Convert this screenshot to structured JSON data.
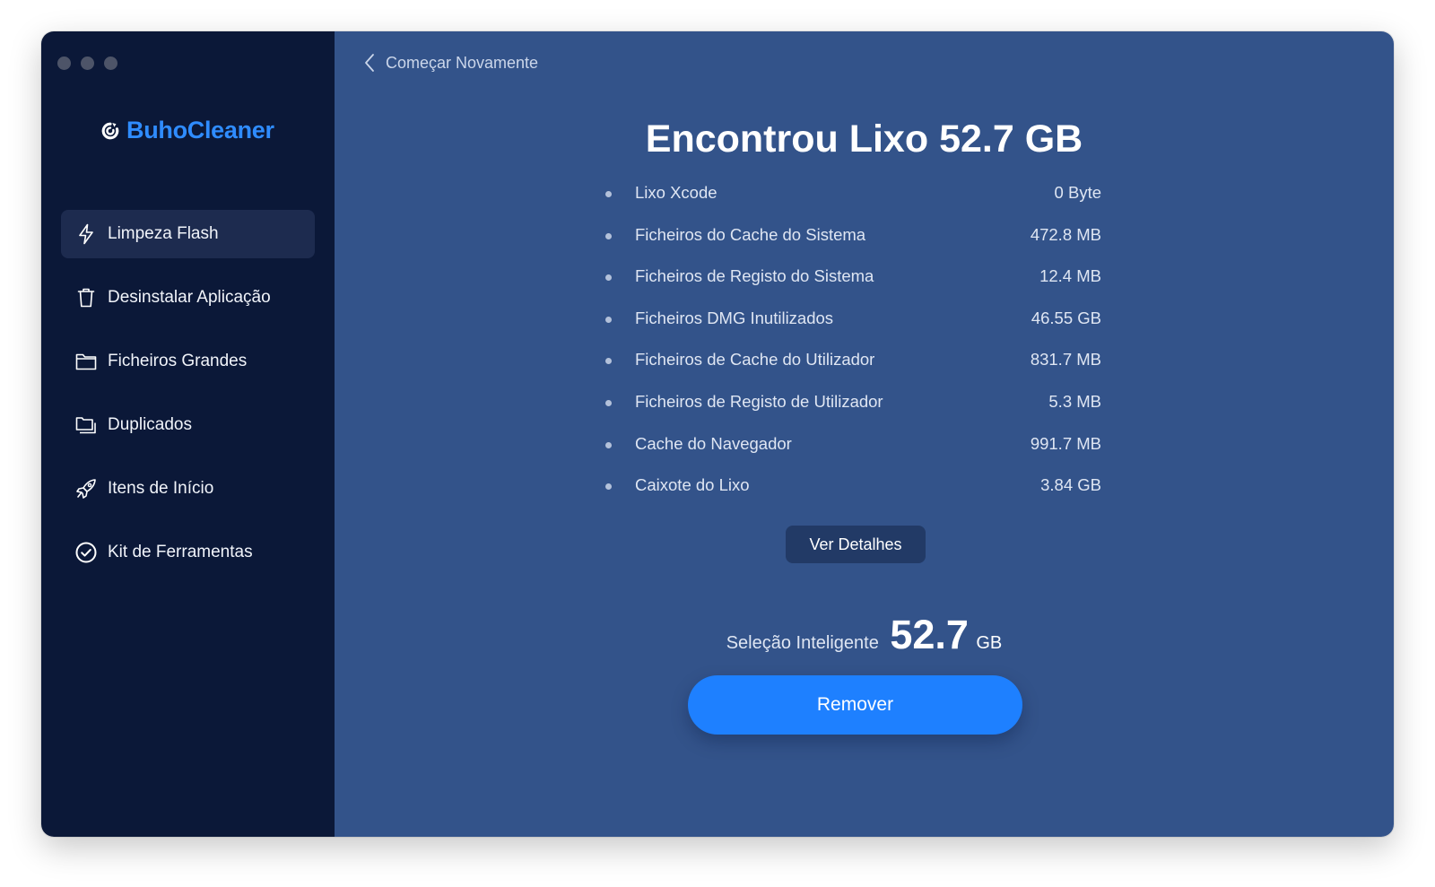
{
  "app": {
    "name": "BuhoCleaner",
    "brand_color": "#2f8cff"
  },
  "sidebar": {
    "items": [
      {
        "label": "Limpeza Flash",
        "icon": "lightning-icon",
        "active": true
      },
      {
        "label": "Desinstalar Aplicação",
        "icon": "trash-icon",
        "active": false
      },
      {
        "label": "Ficheiros Grandes",
        "icon": "folder-icon",
        "active": false
      },
      {
        "label": "Duplicados",
        "icon": "duplicate-folder-icon",
        "active": false
      },
      {
        "label": "Itens de Início",
        "icon": "rocket-icon",
        "active": false
      },
      {
        "label": "Kit de Ferramentas",
        "icon": "check-circle-icon",
        "active": false
      }
    ]
  },
  "main": {
    "back_label": "Começar Novamente",
    "headline": {
      "prefix": "Encontrou Lixo",
      "value": "52.7",
      "unit": "GB"
    },
    "items": [
      {
        "name": "Lixo Xcode",
        "size": "0 Byte"
      },
      {
        "name": "Ficheiros do Cache do Sistema",
        "size": "472.8 MB"
      },
      {
        "name": "Ficheiros de Registo do Sistema",
        "size": "12.4 MB"
      },
      {
        "name": "Ficheiros DMG Inutilizados",
        "size": "46.55 GB"
      },
      {
        "name": "Ficheiros de Cache do Utilizador",
        "size": "831.7 MB"
      },
      {
        "name": "Ficheiros de Registo de Utilizador",
        "size": "5.3 MB"
      },
      {
        "name": "Cache do Navegador",
        "size": "991.7 MB"
      },
      {
        "name": "Caixote do Lixo",
        "size": "3.84 GB"
      }
    ],
    "details_button": "Ver Detalhes",
    "smart_selection": {
      "label": "Seleção Inteligente",
      "value": "52.7",
      "unit": "GB"
    },
    "remove_button": "Remover"
  },
  "colors": {
    "sidebar_bg": "#0b1838",
    "main_bg": "#33538a",
    "primary_button": "#1e80ff"
  }
}
